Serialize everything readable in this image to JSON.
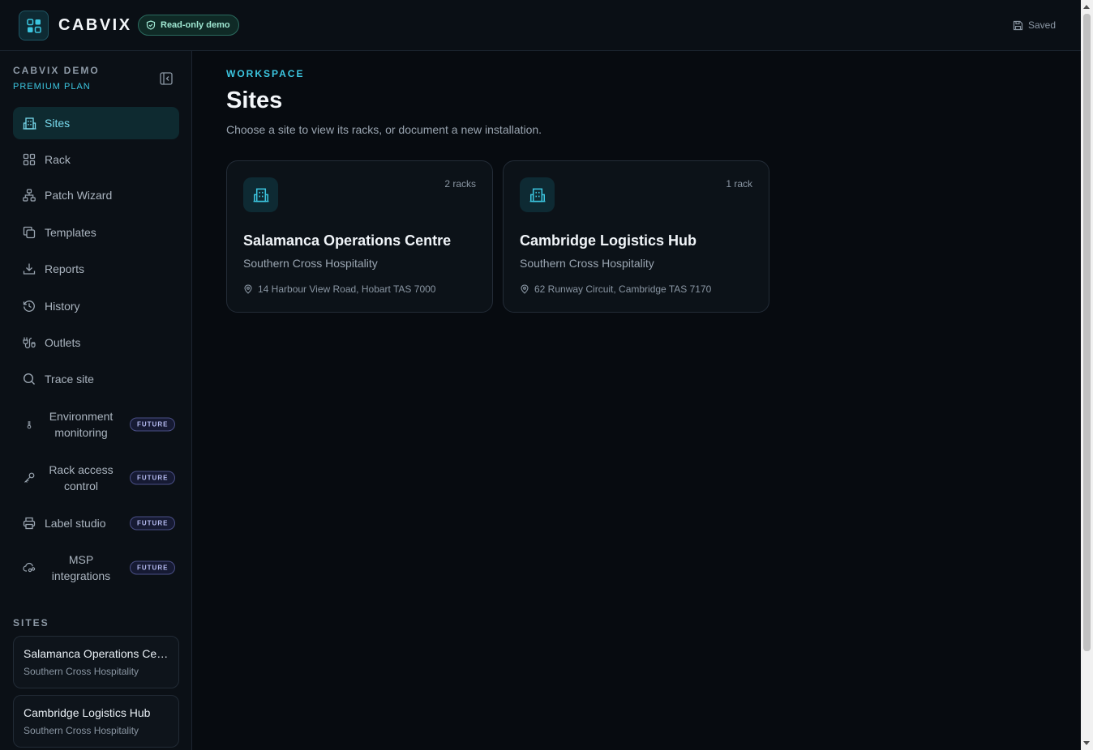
{
  "app": {
    "brand": "CABVIX",
    "demo_badge": "Read-only demo",
    "save_status": "Saved"
  },
  "colors": {
    "accent": "#3cc6e0",
    "background": "#070b10",
    "future_badge": "#b7bcf2"
  },
  "sidebar": {
    "workspace_name": "CABVIX DEMO",
    "plan": "PREMIUM PLAN",
    "nav": [
      {
        "label": "Sites",
        "icon": "building-icon",
        "active": true
      },
      {
        "label": "Rack",
        "icon": "grid-icon"
      },
      {
        "label": "Patch Wizard",
        "icon": "network-icon"
      },
      {
        "label": "Templates",
        "icon": "copy-icon"
      },
      {
        "label": "Reports",
        "icon": "download-icon"
      },
      {
        "label": "History",
        "icon": "history-icon"
      },
      {
        "label": "Outlets",
        "icon": "plug-icon"
      },
      {
        "label": "Trace site",
        "icon": "search-icon"
      },
      {
        "label": "Environment monitoring",
        "icon": "thermometer-icon",
        "badge": "FUTURE"
      },
      {
        "label": "Rack access control",
        "icon": "key-icon",
        "badge": "FUTURE"
      },
      {
        "label": "Label studio",
        "icon": "printer-icon",
        "badge": "FUTURE"
      },
      {
        "label": "MSP integrations",
        "icon": "cloud-link-icon",
        "badge": "FUTURE"
      }
    ],
    "sites_heading": "SITES",
    "sites": [
      {
        "name": "Salamanca Operations Centre",
        "org": "Southern Cross Hospitality"
      },
      {
        "name": "Cambridge Logistics Hub",
        "org": "Southern Cross Hospitality"
      }
    ]
  },
  "main": {
    "eyebrow": "WORKSPACE",
    "title": "Sites",
    "subtitle": "Choose a site to view its racks, or document a new installation.",
    "cards": [
      {
        "name": "Salamanca Operations Centre",
        "org": "Southern Cross Hospitality",
        "racks": "2 racks",
        "address": "14 Harbour View Road, Hobart TAS 7000"
      },
      {
        "name": "Cambridge Logistics Hub",
        "org": "Southern Cross Hospitality",
        "racks": "1 rack",
        "address": "62 Runway Circuit, Cambridge TAS 7170"
      }
    ]
  }
}
